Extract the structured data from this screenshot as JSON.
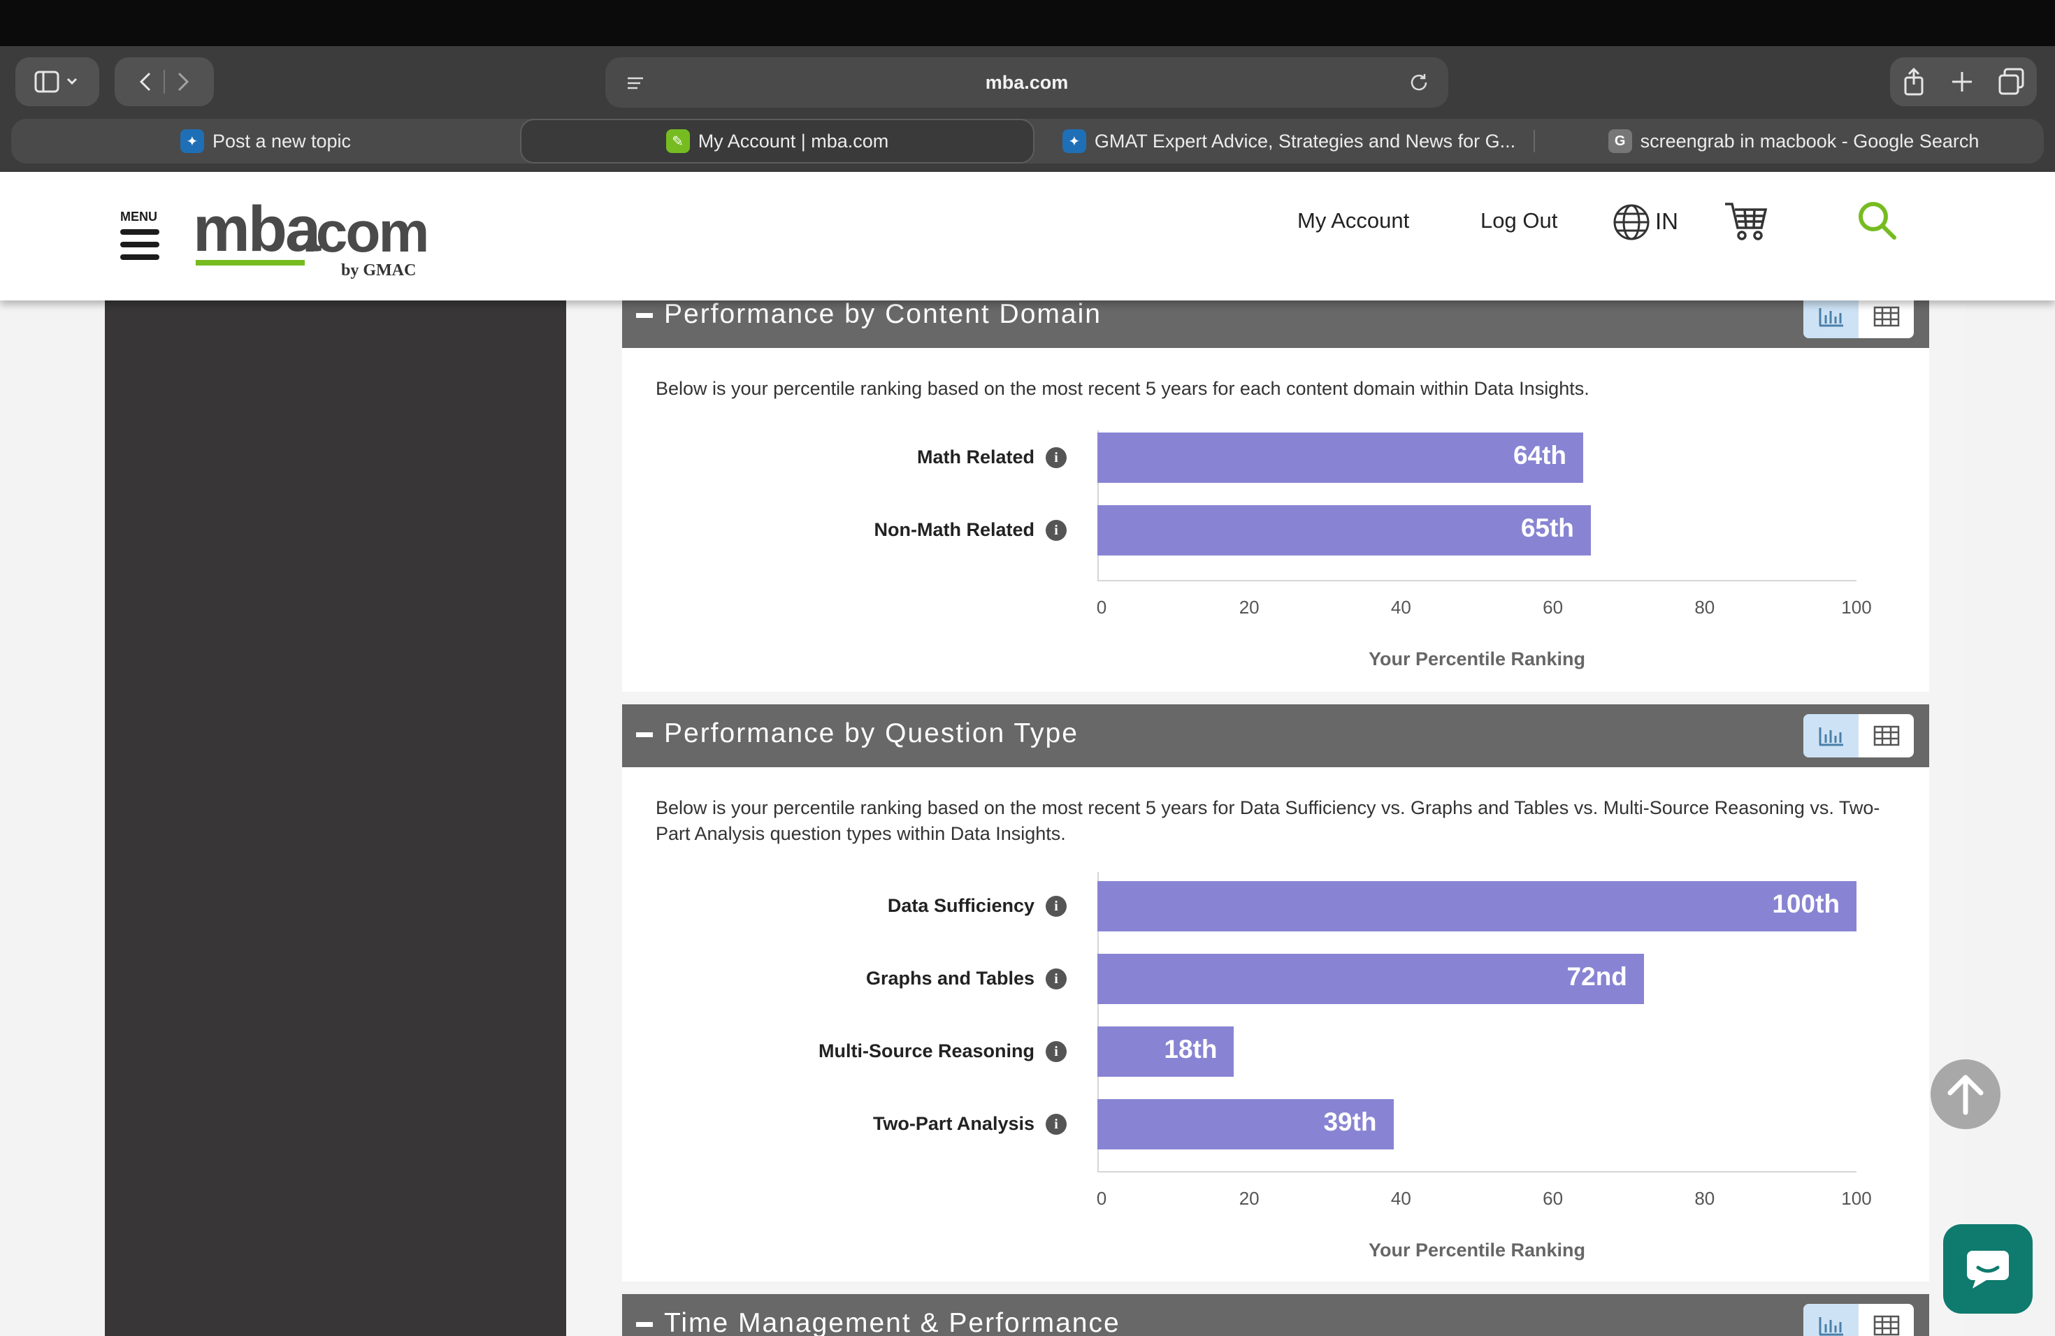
{
  "browser": {
    "url": "mba.com",
    "tabs": [
      {
        "label": "Post a new topic",
        "active": false
      },
      {
        "label": "My Account | mba.com",
        "active": true
      },
      {
        "label": "GMAT Expert Advice, Strategies and News for G...",
        "active": false
      },
      {
        "label": "screengrab in macbook - Google Search",
        "active": false
      }
    ]
  },
  "header": {
    "menu_label": "MENU",
    "logo": {
      "mba": "mba",
      "dotcom": ".com",
      "by": "by GMAC"
    },
    "my_account": "My Account",
    "log_out": "Log Out",
    "region": "IN"
  },
  "sections": {
    "content_domain": {
      "title": "Performance by Content Domain",
      "description": "Below is your percentile ranking based on the most recent 5 years for each content domain within Data Insights.",
      "axis_title": "Your Percentile Ranking"
    },
    "question_type": {
      "title": "Performance by Question Type",
      "description": "Below is your percentile ranking based on the most recent 5 years for Data Sufficiency vs. Graphs and Tables vs. Multi-Source Reasoning vs. Two-Part Analysis question types within Data Insights.",
      "axis_title": "Your Percentile Ranking"
    },
    "time_management": {
      "title": "Time Management & Performance"
    }
  },
  "chart_data": [
    {
      "type": "bar",
      "orientation": "horizontal",
      "categories": [
        "Math Related",
        "Non-Math Related"
      ],
      "values": [
        64,
        65
      ],
      "value_labels": [
        "64th",
        "65th"
      ],
      "xlabel": "Your Percentile Ranking",
      "xlim": [
        0,
        100
      ],
      "xticks": [
        "0",
        "20",
        "40",
        "60",
        "80",
        "100"
      ],
      "color": "#8884d3"
    },
    {
      "type": "bar",
      "orientation": "horizontal",
      "categories": [
        "Data Sufficiency",
        "Graphs and Tables",
        "Multi-Source Reasoning",
        "Two-Part Analysis"
      ],
      "values": [
        100,
        72,
        18,
        39
      ],
      "value_labels": [
        "100th",
        "72nd",
        "18th",
        "39th"
      ],
      "xlabel": "Your Percentile Ranking",
      "xlim": [
        0,
        100
      ],
      "xticks": [
        "0",
        "20",
        "40",
        "60",
        "80",
        "100"
      ],
      "color": "#8884d3"
    }
  ],
  "colors": {
    "bar": "#8884d3",
    "section_header": "#686868",
    "sidebar": "#383636",
    "brand_green": "#76bc21",
    "search_green": "#76bc21",
    "chat": "#0f7a6e"
  },
  "icons": [
    "sidebar-toggle-icon",
    "chevron-down-icon",
    "back-icon",
    "forward-icon",
    "reader-icon",
    "reload-icon",
    "share-icon",
    "plus-icon",
    "tabs-overview-icon",
    "globe-icon",
    "cart-icon",
    "search-icon",
    "bar-chart-icon",
    "table-icon",
    "info-icon",
    "arrow-up-icon",
    "chat-icon"
  ]
}
